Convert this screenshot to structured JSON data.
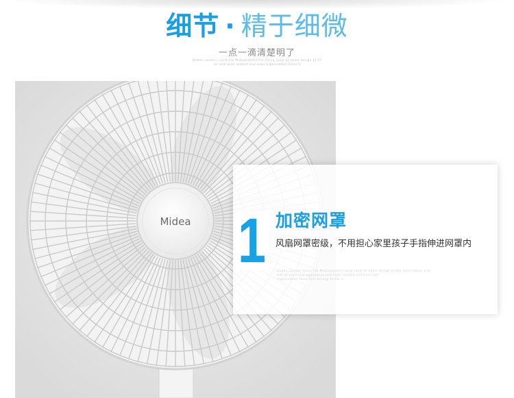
{
  "header": {
    "title_bold": "细节",
    "title_dot": "·",
    "title_light": "精于细微",
    "subtitle": "一点一滴清楚明了",
    "fine_lines": [
      "Deden Lantern icons life Measurement for living room at home design to fit",
      "its and room related and even organization Ferni S"
    ]
  },
  "photo": {
    "brand": "Midea"
  },
  "feature": {
    "number": "1",
    "title": "加密网罩",
    "description": "风扇网罩密级，不用担心家里孩子手指伸进网罩内",
    "fine_lines": [
      "Deden Lantern icons life Measurement living room at home design to the home decor a ke",
      "ries of electrical appliances and room related and even and",
      "organization Ferni Sale belong to the c"
    ]
  },
  "colors": {
    "accent": "#1a9fe0",
    "accent_light": "#5bbcea",
    "photo_bg": "#e5e5e5"
  }
}
